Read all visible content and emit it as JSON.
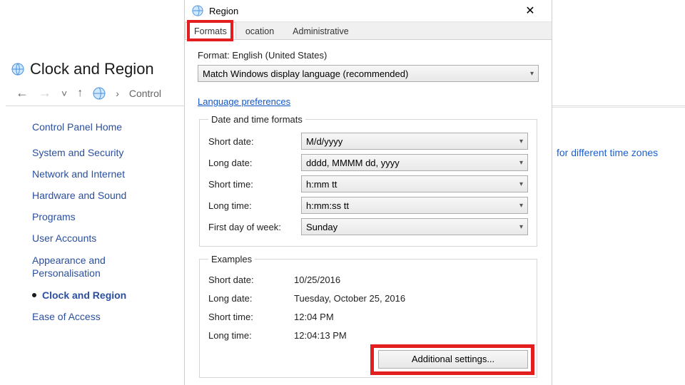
{
  "cp": {
    "title": "Clock and Region",
    "breadcrumb": "Control",
    "home": "Control Panel Home",
    "items": [
      "System and Security",
      "Network and Internet",
      "Hardware and Sound",
      "Programs",
      "User Accounts",
      "Appearance and Personalisation"
    ],
    "current": "Clock and Region",
    "last": "Ease of Access",
    "right_link": "for different time zones"
  },
  "dlg": {
    "title": "Region",
    "tabs": {
      "formats": "Formats",
      "location": "ocation",
      "admin": "Administrative"
    },
    "format_label": "Format: English (United States)",
    "format_select": "Match Windows display language (recommended)",
    "lang_pref": "Language preferences",
    "group_dtf": "Date and time formats",
    "k_shortdate": "Short date:",
    "k_longdate": "Long date:",
    "k_shorttime": "Short time:",
    "k_longtime": "Long time:",
    "k_firstday": "First day of week:",
    "v_shortdate": "M/d/yyyy",
    "v_longdate": "dddd, MMMM dd, yyyy",
    "v_shorttime": "h:mm tt",
    "v_longtime": "h:mm:ss tt",
    "v_firstday": "Sunday",
    "group_ex": "Examples",
    "ex_shortdate": "10/25/2016",
    "ex_longdate": "Tuesday, October 25, 2016",
    "ex_shorttime": "12:04 PM",
    "ex_longtime": "12:04:13 PM",
    "btn_additional": "Additional settings..."
  }
}
